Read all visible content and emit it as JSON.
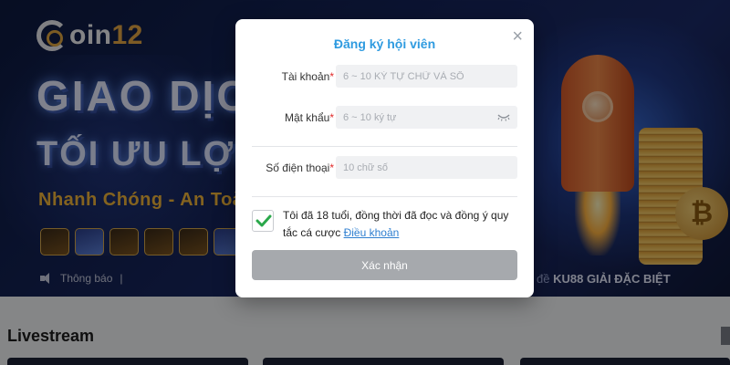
{
  "background": {
    "logo": {
      "prefix": "oin",
      "number": "12"
    },
    "headline_line1": "GIAO DỊCH",
    "headline_line2": "TỐI ƯU LỢI NH",
    "tagline": "Nhanh Chóng - An Toà",
    "notice_label": "Thông báo",
    "notice_separator": "|",
    "promo_prefix": "đề",
    "promo_text": "KU88 GIẢI ĐẶC BIỆT",
    "coin_symbol": "₿",
    "section_title": "Livestream"
  },
  "modal": {
    "title": "Đăng ký hội viên",
    "close_symbol": "×",
    "fields": {
      "account": {
        "label": "Tài khoản",
        "required_mark": "*",
        "placeholder": "6 ~ 10 KÝ TỰ CHỮ VÀ SỐ"
      },
      "password": {
        "label": "Mật khẩu",
        "required_mark": "*",
        "placeholder": "6 ~ 10 ký tự"
      },
      "phone": {
        "label": "Số điện thoại",
        "required_mark": "*",
        "placeholder": "10 chữ số"
      }
    },
    "agreement": {
      "checked": true,
      "text": "Tôi đã 18 tuổi, đồng thời đã đọc và đồng ý quy tắc cá cược ",
      "link_text": "Điều khoản"
    },
    "submit_label": "Xác nhận"
  },
  "colors": {
    "title_blue": "#2f9be0",
    "required_red": "#e02b2b",
    "check_green": "#2aa84a",
    "button_gray": "#a6a9ad",
    "link_blue": "#2f7fd0",
    "tagline_gold": "#f0b43a"
  },
  "icons": {
    "close": "close-icon",
    "eye": "eye-closed-icon",
    "check": "checkmark-icon",
    "speaker": "speaker-icon"
  }
}
